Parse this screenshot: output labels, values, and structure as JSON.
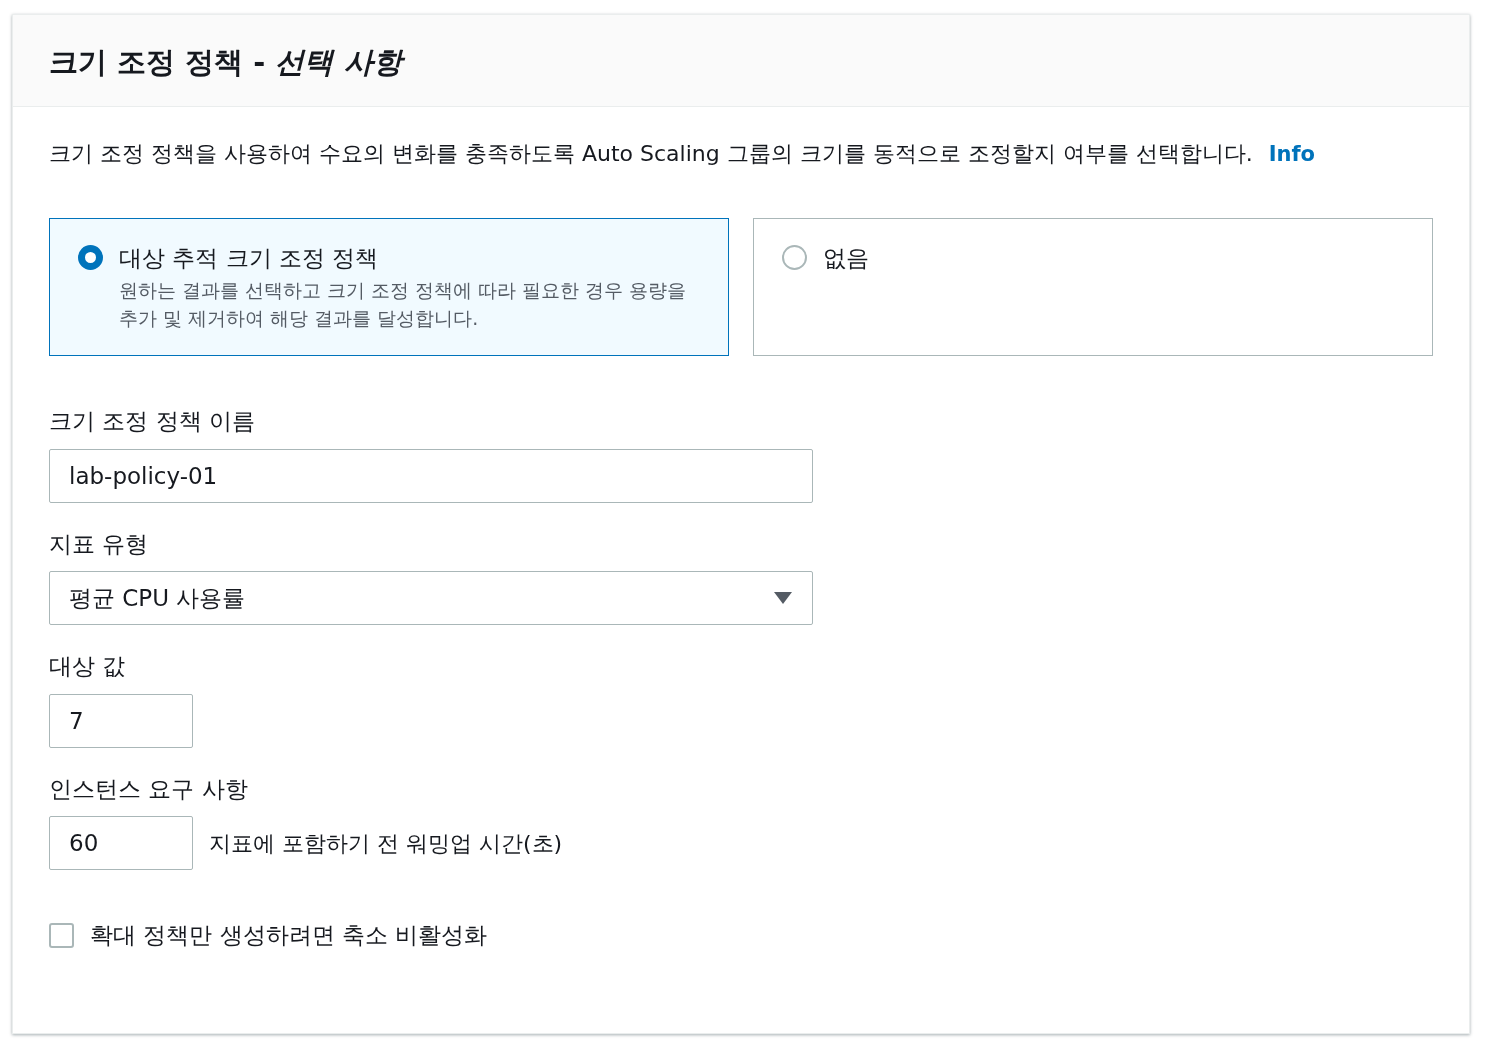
{
  "panel": {
    "title": "크기 조정 정책 - *선택 사항*",
    "description": "크기 조정 정책을 사용하여 수요의 변화를 충족하도록 Auto Scaling 그룹의 크기를 동적으로 조정할지 여부를 선택합니다.",
    "info_link": "Info",
    "options": [
      {
        "label": "대상 추적 크기 조정 정책",
        "description": "원하는 결과를 선택하고 크기 조정 정책에 따라 필요한 경우 용량을 추가 및 제거하여 해당 결과를 달성합니다.",
        "selected": true
      },
      {
        "label": "없음",
        "selected": false
      }
    ],
    "fields": [
      {
        "kind": "text",
        "label": "크기 조정 정책 이름",
        "value": "lab-policy-01"
      },
      {
        "kind": "select",
        "label": "지표 유형",
        "value": "평균 CPU 사용률"
      },
      {
        "kind": "number",
        "label": "대상 값",
        "value": "7"
      },
      {
        "kind": "number",
        "label": "인스턴스 요구 사항",
        "value": "60",
        "suffix": "지표에 포함하기 전 워밍업 시간(초)"
      }
    ],
    "checkbox": {
      "label": "확대 정책만 생성하려면 축소 비활성화",
      "checked": false
    }
  }
}
